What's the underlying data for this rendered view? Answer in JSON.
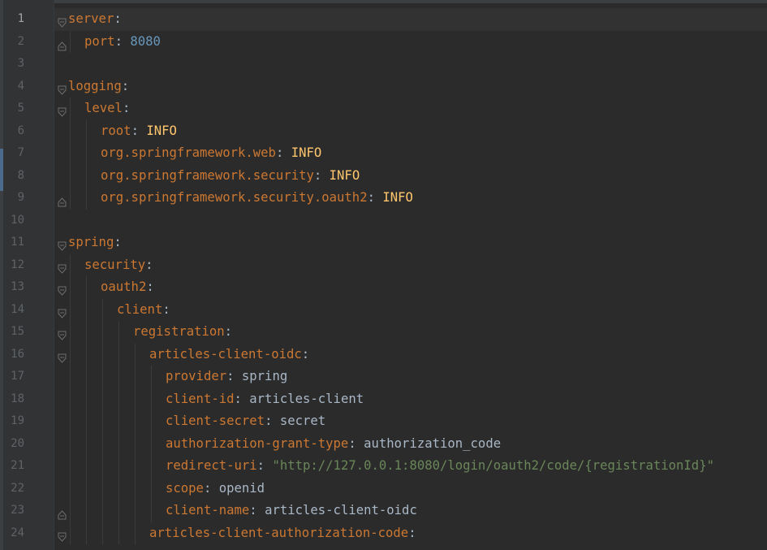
{
  "editor": {
    "current_line": 1,
    "lines": [
      {
        "num": "1",
        "indent": 0,
        "key": "server",
        "sep": ":",
        "value": "",
        "vclass": "v",
        "fold": "open"
      },
      {
        "num": "2",
        "indent": 1,
        "key": "port",
        "sep": ":",
        "value": "8080",
        "vclass": "n",
        "fold": "end"
      },
      {
        "num": "3",
        "indent": 0,
        "key": "",
        "sep": "",
        "value": "",
        "vclass": "v",
        "fold": ""
      },
      {
        "num": "4",
        "indent": 0,
        "key": "logging",
        "sep": ":",
        "value": "",
        "vclass": "v",
        "fold": "open"
      },
      {
        "num": "5",
        "indent": 1,
        "key": "level",
        "sep": ":",
        "value": "",
        "vclass": "v",
        "fold": "open"
      },
      {
        "num": "6",
        "indent": 2,
        "key": "root",
        "sep": ":",
        "value": "INFO",
        "vclass": "c",
        "fold": ""
      },
      {
        "num": "7",
        "indent": 2,
        "key": "org.springframework.web",
        "sep": ":",
        "value": "INFO",
        "vclass": "c",
        "fold": ""
      },
      {
        "num": "8",
        "indent": 2,
        "key": "org.springframework.security",
        "sep": ":",
        "value": "INFO",
        "vclass": "c",
        "fold": ""
      },
      {
        "num": "9",
        "indent": 2,
        "key": "org.springframework.security.oauth2",
        "sep": ":",
        "value": "INFO",
        "vclass": "c",
        "fold": "end"
      },
      {
        "num": "10",
        "indent": 0,
        "key": "",
        "sep": "",
        "value": "",
        "vclass": "v",
        "fold": ""
      },
      {
        "num": "11",
        "indent": 0,
        "key": "spring",
        "sep": ":",
        "value": "",
        "vclass": "v",
        "fold": "open"
      },
      {
        "num": "12",
        "indent": 1,
        "key": "security",
        "sep": ":",
        "value": "",
        "vclass": "v",
        "fold": "open"
      },
      {
        "num": "13",
        "indent": 2,
        "key": "oauth2",
        "sep": ":",
        "value": "",
        "vclass": "v",
        "fold": "open"
      },
      {
        "num": "14",
        "indent": 3,
        "key": "client",
        "sep": ":",
        "value": "",
        "vclass": "v",
        "fold": "open"
      },
      {
        "num": "15",
        "indent": 4,
        "key": "registration",
        "sep": ":",
        "value": "",
        "vclass": "v",
        "fold": "open"
      },
      {
        "num": "16",
        "indent": 5,
        "key": "articles-client-oidc",
        "sep": ":",
        "value": "",
        "vclass": "v",
        "fold": "open"
      },
      {
        "num": "17",
        "indent": 6,
        "key": "provider",
        "sep": ":",
        "value": "spring",
        "vclass": "v",
        "fold": ""
      },
      {
        "num": "18",
        "indent": 6,
        "key": "client-id",
        "sep": ":",
        "value": "articles-client",
        "vclass": "v",
        "fold": ""
      },
      {
        "num": "19",
        "indent": 6,
        "key": "client-secret",
        "sep": ":",
        "value": "secret",
        "vclass": "v",
        "fold": ""
      },
      {
        "num": "20",
        "indent": 6,
        "key": "authorization-grant-type",
        "sep": ":",
        "value": "authorization_code",
        "vclass": "v",
        "fold": ""
      },
      {
        "num": "21",
        "indent": 6,
        "key": "redirect-uri",
        "sep": ":",
        "value": "\"http://127.0.0.1:8080/login/oauth2/code/{registrationId}\"",
        "vclass": "s",
        "fold": ""
      },
      {
        "num": "22",
        "indent": 6,
        "key": "scope",
        "sep": ":",
        "value": "openid",
        "vclass": "v",
        "fold": ""
      },
      {
        "num": "23",
        "indent": 6,
        "key": "client-name",
        "sep": ":",
        "value": "articles-client-oidc",
        "vclass": "v",
        "fold": "end"
      },
      {
        "num": "24",
        "indent": 5,
        "key": "articles-client-authorization-code",
        "sep": ":",
        "value": "",
        "vclass": "v",
        "fold": "open"
      }
    ]
  }
}
